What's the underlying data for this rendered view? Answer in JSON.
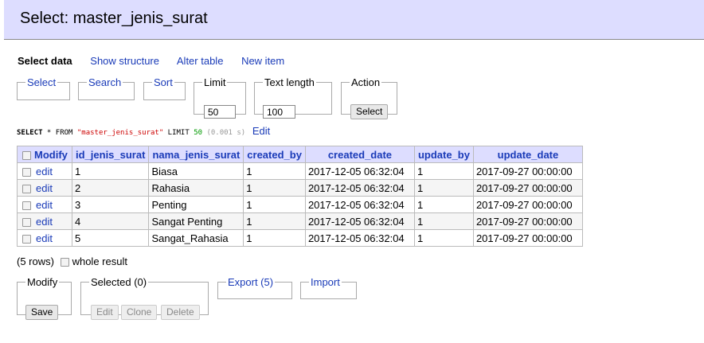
{
  "header": {
    "title": "Select: master_jenis_surat"
  },
  "nav": {
    "select_data": "Select data",
    "show_structure": "Show structure",
    "alter_table": "Alter table",
    "new_item": "New item"
  },
  "filters": {
    "select_legend": "Select",
    "search_legend": "Search",
    "sort_legend": "Sort",
    "limit_legend": "Limit",
    "limit_value": "50",
    "textlength_legend": "Text length",
    "textlength_value": "100",
    "action_legend": "Action",
    "action_button": "Select"
  },
  "sql": {
    "k_select": "SELECT",
    "star_from": " * FROM ",
    "table": "\"master_jenis_surat\"",
    "k_limit": " LIMIT ",
    "limit": "50",
    "time": " (0.001 s)",
    "edit_link": "Edit"
  },
  "table": {
    "modify_header": "Modify",
    "columns": [
      "id_jenis_surat",
      "nama_jenis_surat",
      "created_by",
      "created_date",
      "update_by",
      "update_date"
    ],
    "edit_label": "edit",
    "rows": [
      [
        "1",
        "Biasa",
        "1",
        "2017-12-05 06:32:04",
        "1",
        "2017-09-27 00:00:00"
      ],
      [
        "2",
        "Rahasia",
        "1",
        "2017-12-05 06:32:04",
        "1",
        "2017-09-27 00:00:00"
      ],
      [
        "3",
        "Penting",
        "1",
        "2017-12-05 06:32:04",
        "1",
        "2017-09-27 00:00:00"
      ],
      [
        "4",
        "Sangat Penting",
        "1",
        "2017-12-05 06:32:04",
        "1",
        "2017-09-27 00:00:00"
      ],
      [
        "5",
        "Sangat_Rahasia",
        "1",
        "2017-12-05 06:32:04",
        "1",
        "2017-09-27 00:00:00"
      ]
    ]
  },
  "footer": {
    "rows_count": "(5 rows)",
    "whole_result": "whole result",
    "modify_legend": "Modify",
    "save_button": "Save",
    "selected_legend": "Selected (0)",
    "edit_button": "Edit",
    "clone_button": "Clone",
    "delete_button": "Delete",
    "export_legend": "Export (5)",
    "import_legend": "Import"
  }
}
